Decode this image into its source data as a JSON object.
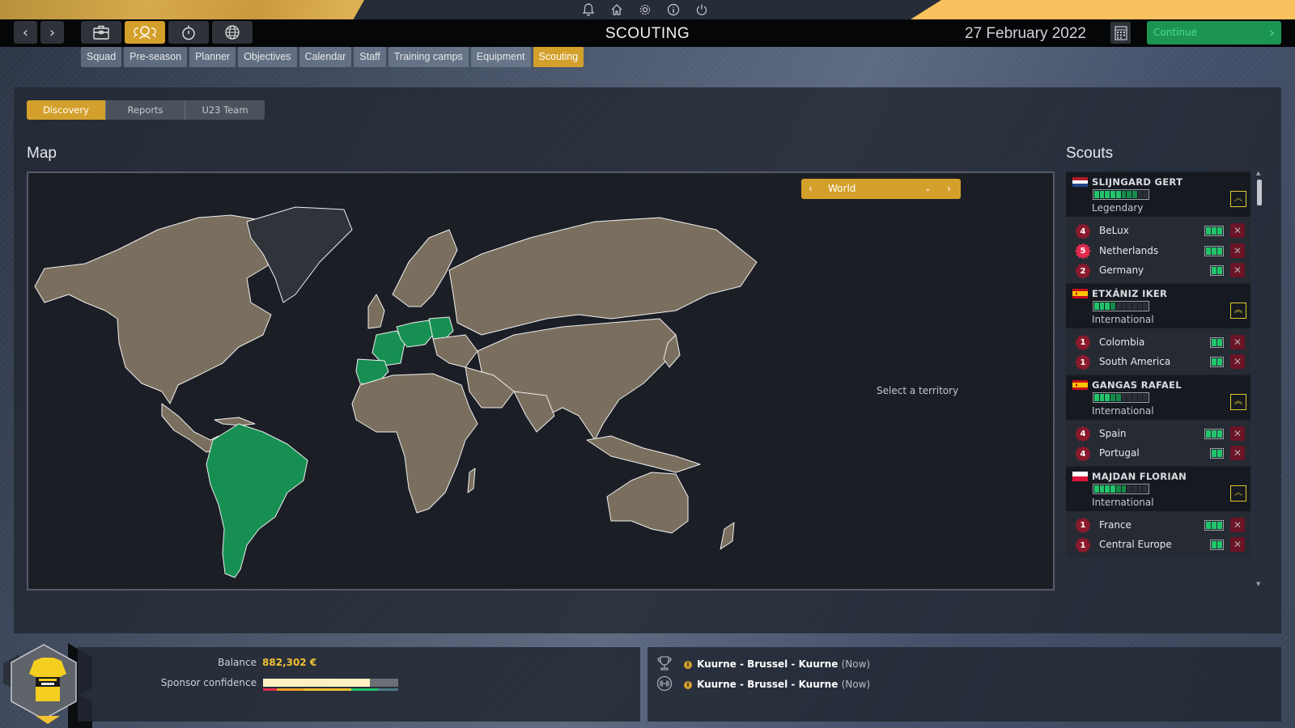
{
  "topbar": {
    "icons": [
      "bell-icon",
      "home-icon",
      "gear-icon",
      "info-icon",
      "power-icon"
    ]
  },
  "header": {
    "title": "SCOUTING",
    "date": "27 February 2022",
    "continue_label": "Continue",
    "mode_icons": [
      "briefcase-icon",
      "team-icon",
      "stopwatch-icon",
      "globe-icon"
    ],
    "active_mode": 1
  },
  "subnav": {
    "items": [
      "Squad",
      "Pre-season",
      "Planner",
      "Objectives",
      "Calendar",
      "Staff",
      "Training camps",
      "Equipment",
      "Scouting"
    ],
    "active": "Scouting"
  },
  "tabs": {
    "items": [
      "Discovery",
      "Reports",
      "U23 Team"
    ],
    "active": "Discovery"
  },
  "map": {
    "heading": "Map",
    "region_selector": "World",
    "hint": "Select a territory",
    "colors": {
      "land": "#7a6f5e",
      "scouted": "#188f52",
      "sea": "#1b1e25",
      "border": "#f0f0f0"
    },
    "scouted_territories": [
      "BeLux",
      "Netherlands",
      "Germany",
      "Colombia",
      "South America",
      "Spain",
      "Portugal",
      "France",
      "Central Europe"
    ]
  },
  "scouts": {
    "heading": "Scouts",
    "list": [
      {
        "name": "SLIJNGARD GERT",
        "flag": "netherlands",
        "rank": "Legendary",
        "level": 8,
        "level_max": 10,
        "expand_icon": "chevron-up-icon",
        "assignments": [
          {
            "territory": "BeLux",
            "badge": "4",
            "hot": false,
            "progress": 3
          },
          {
            "territory": "Netherlands",
            "badge": "5",
            "hot": true,
            "progress": 3
          },
          {
            "territory": "Germany",
            "badge": "2",
            "hot": false,
            "progress": 2
          }
        ]
      },
      {
        "name": "ETXÁNIZ IKER",
        "flag": "spain",
        "rank": "International",
        "level": 4,
        "level_max": 10,
        "expand_icon": "double-chevron-up-icon",
        "assignments": [
          {
            "territory": "Colombia",
            "badge": "1",
            "hot": false,
            "progress": 2
          },
          {
            "territory": "South America",
            "badge": "1",
            "hot": false,
            "progress": 2
          }
        ]
      },
      {
        "name": "GANGAS RAFAEL",
        "flag": "spain",
        "rank": "International",
        "level": 5,
        "level_max": 10,
        "expand_icon": "double-chevron-up-icon",
        "assignments": [
          {
            "territory": "Spain",
            "badge": "4",
            "hot": false,
            "progress": 3
          },
          {
            "territory": "Portugal",
            "badge": "4",
            "hot": false,
            "progress": 2
          }
        ]
      },
      {
        "name": "MAJDAN FLORIAN",
        "flag": "poland",
        "rank": "International",
        "level": 6,
        "level_max": 10,
        "expand_icon": "chevron-up-icon",
        "assignments": [
          {
            "territory": "France",
            "badge": "1",
            "hot": false,
            "progress": 3
          },
          {
            "territory": "Central Europe",
            "badge": "1",
            "hot": false,
            "progress": 2
          }
        ]
      }
    ]
  },
  "finance": {
    "balance_label": "Balance",
    "balance_value": "882,302 €",
    "sponsor_label": "Sponsor confidence",
    "sponsor_confidence": 0.79
  },
  "events": [
    {
      "icon": "trophy-icon",
      "race": "Kuurne - Brussel - Kuurne",
      "status": "(Now)"
    },
    {
      "icon": "dumbbell-icon",
      "race": "Kuurne - Brussel - Kuurne",
      "status": "(Now)"
    }
  ],
  "colors": {
    "accent": "#d4a02c",
    "continue": "#1d9552",
    "level_bar": "#22c46a",
    "remove": "#6a1425"
  }
}
